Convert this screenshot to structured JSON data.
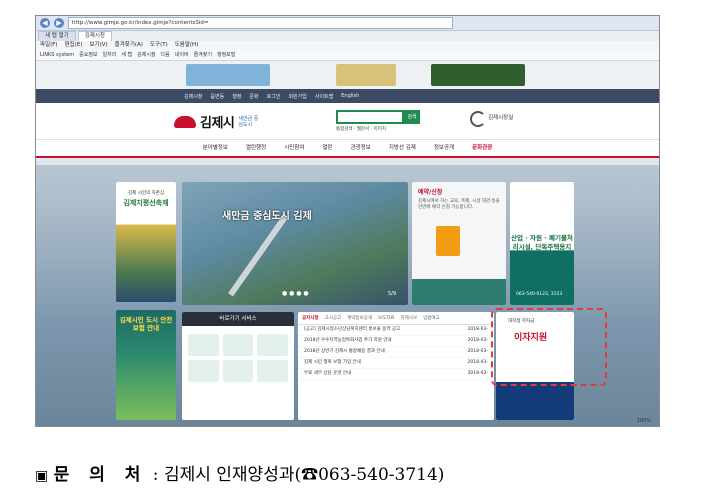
{
  "browser": {
    "url": "http://www.gimje.go.kr/index.gimje?contentsSid=",
    "tabs": [
      "새 탭 열기",
      "김제시청"
    ],
    "menu": [
      "파일(F)",
      "편집(E)",
      "보기(V)",
      "즐겨찾기(A)",
      "도구(T)",
      "도움말(H)"
    ],
    "favorites": [
      "LINKS system",
      "중요정보",
      "일자리",
      "새 탭",
      "김제시청",
      "다음",
      "네이버",
      "즐겨찾기",
      "행정포털"
    ],
    "status_zoom": "100%"
  },
  "site": {
    "util_links": [
      "김제시청",
      "읍면동",
      "행정",
      "문화",
      "로그인",
      "회원가입",
      "사이트맵",
      "English"
    ],
    "logo_text": "김제시",
    "logo_sub": "새만금 중심도시",
    "search_button": "검색",
    "search_opts": "통합검색 · 웹문서 · 이미지",
    "mayor_label": "김제시장실",
    "gnb": [
      "분야별정보",
      "열린행정",
      "시민참여",
      "열린",
      "관광정보",
      "지방선 김제",
      "정보공개",
      "문화관광"
    ],
    "gnb_active_index": 7
  },
  "visual": {
    "left_card_top": "김제 시민의 자존심",
    "left_card_title": "김제지평선축제",
    "main_headline": "새만금 중심도시 김제",
    "main_counter": "5/9",
    "side_head": "예약/신청",
    "side_body": "김제시에서 하는 교육, 축제, 시설 대관 등을 한번에 예약 신청 가능합니다.",
    "right_card_title": "산업 · 자원 · 폐기물처리시설, 단독주택용지",
    "right_card_phone": "063-540-0123, 3153",
    "left2_title": "김제시민 도시 안전 보험 안내",
    "quick_header": "바로가기 서비스",
    "news_tabs": [
      "공지사항",
      "고시공고",
      "계약정보공개",
      "보도자료",
      "김제시보",
      "입법예고"
    ],
    "news_items": [
      {
        "title": "[공고] 김제시청소년상담복지센터 홍보물 용역 공고",
        "date": "2018-03-"
      },
      {
        "title": "2018년 우수지역농업특화사업 추가 지원 안내",
        "date": "2018-03-"
      },
      {
        "title": "2018년 상반기 김제시 통합채용 결과 안내",
        "date": "2018-03-"
      },
      {
        "title": "김제 시민 행복 보험 가입 안내",
        "date": "2018-03-"
      },
      {
        "title": "무료 세무 상담 운영 안내",
        "date": "2018-03-"
      }
    ],
    "adv_pre": "대학생 학자금",
    "adv_head": "이자지원"
  },
  "contact": {
    "marker": "▣",
    "label": "문 의 처",
    "sep": " : ",
    "dept": "김제시 인재양성과",
    "phone": "(☎063-540-3714)"
  }
}
